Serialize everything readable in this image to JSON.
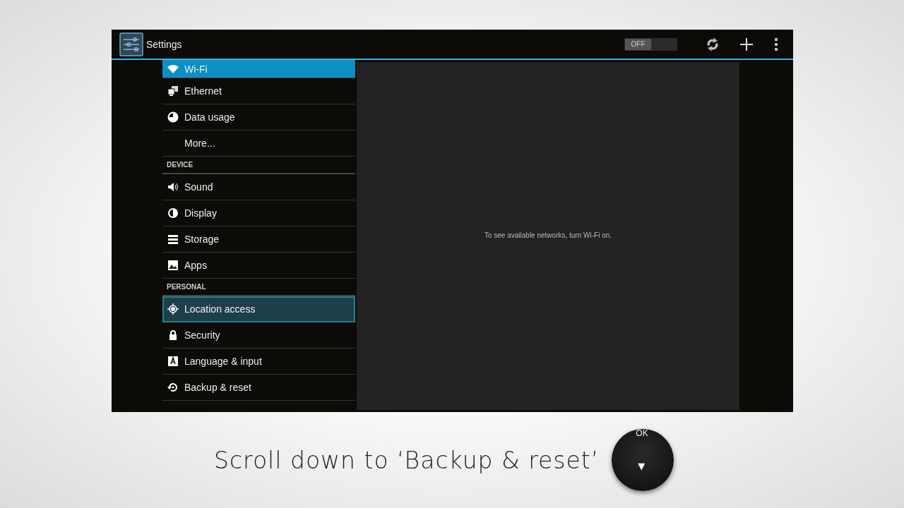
{
  "action_bar": {
    "title": "Settings",
    "wifi_toggle": {
      "label": "OFF",
      "on": false
    }
  },
  "sidebar": {
    "items": [
      {
        "kind": "item",
        "label": "Wi-Fi",
        "selected": true,
        "focused": false
      },
      {
        "kind": "item",
        "label": "Ethernet",
        "selected": false,
        "focused": false
      },
      {
        "kind": "item",
        "label": "Data usage",
        "selected": false,
        "focused": false
      },
      {
        "kind": "item",
        "label": "More...",
        "selected": false,
        "focused": false
      },
      {
        "kind": "header",
        "label": "DEVICE"
      },
      {
        "kind": "item",
        "label": "Sound",
        "selected": false,
        "focused": false
      },
      {
        "kind": "item",
        "label": "Display",
        "selected": false,
        "focused": false
      },
      {
        "kind": "item",
        "label": "Storage",
        "selected": false,
        "focused": false
      },
      {
        "kind": "item",
        "label": "Apps",
        "selected": false,
        "focused": false
      },
      {
        "kind": "header",
        "label": "PERSONAL"
      },
      {
        "kind": "item",
        "label": "Location access",
        "selected": false,
        "focused": true
      },
      {
        "kind": "item",
        "label": "Security",
        "selected": false,
        "focused": false
      },
      {
        "kind": "item",
        "label": "Language & input",
        "selected": false,
        "focused": false
      },
      {
        "kind": "item",
        "label": "Backup & reset",
        "selected": false,
        "focused": false
      }
    ]
  },
  "content": {
    "message": "To see available networks, turn Wi-Fi on."
  },
  "caption": "Scroll down to ‘Backup & reset’",
  "remote": {
    "ok_label": "OK",
    "arrow": "▼"
  }
}
